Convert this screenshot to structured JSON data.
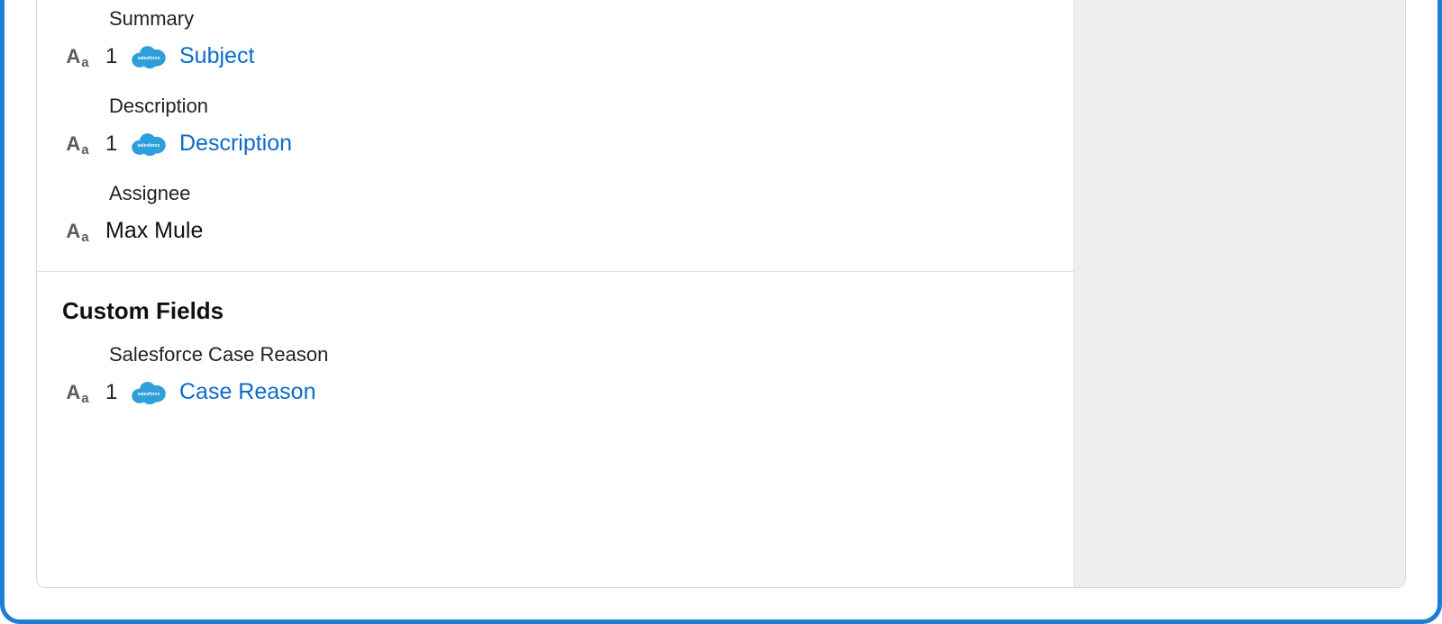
{
  "sections": {
    "standard": {
      "fields": {
        "summary": {
          "label": "Summary",
          "order": "1",
          "pill": "Subject",
          "hasCloud": true
        },
        "description": {
          "label": "Description",
          "order": "1",
          "pill": "Description",
          "hasCloud": true
        },
        "assignee": {
          "label": "Assignee",
          "value": "Max Mule"
        }
      }
    },
    "custom": {
      "title": "Custom Fields",
      "fields": {
        "caseReason": {
          "label": "Salesforce Case Reason",
          "order": "1",
          "pill": "Case Reason",
          "hasCloud": true
        }
      }
    }
  },
  "icons": {
    "cloudLabel": "salesforce"
  },
  "colors": {
    "frame": "#1c7ed6",
    "link": "#0b6cc9",
    "cloud": "#2f9fdb"
  }
}
